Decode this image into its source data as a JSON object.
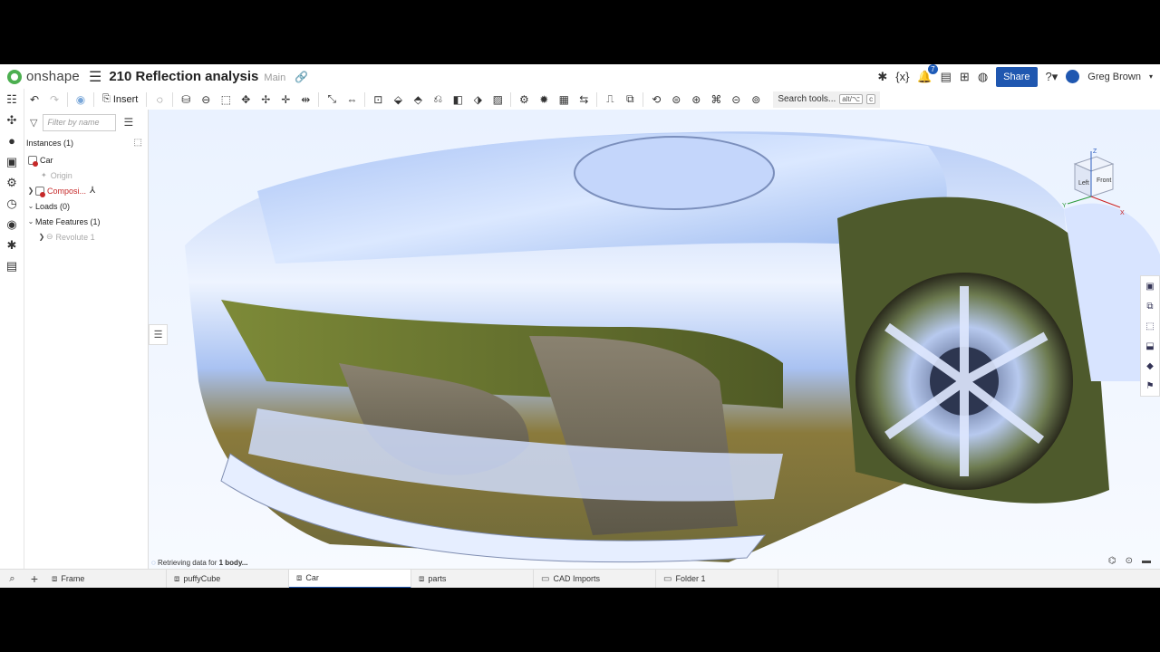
{
  "header": {
    "brand": "onshape",
    "doc_title": "210 Reflection analysis",
    "workspace": "Main",
    "notification_count": "7",
    "share_label": "Share",
    "user_name": "Greg Brown"
  },
  "toolbar": {
    "insert_label": "Insert",
    "search_label": "Search tools...",
    "search_shortcut": "alt/⌥",
    "search_shortcut_key": "c"
  },
  "tree": {
    "filter_placeholder": "Filter by name",
    "instances": "Instances (1)",
    "car": "Car",
    "origin": "Origin",
    "composite": "Composi...",
    "loads": "Loads (0)",
    "mate_features": "Mate Features (1)",
    "revolute": "Revolute 1"
  },
  "viewport": {
    "status_prefix": "Retrieving data for",
    "status_bold": "1 body...",
    "cube_left": "Left",
    "cube_front": "Front",
    "axis_z": "Z",
    "axis_y": "Y",
    "axis_x": "X"
  },
  "tabs": [
    {
      "label": "Frame",
      "icon": "assembly-icon"
    },
    {
      "label": "puffyCube",
      "icon": "assembly-icon"
    },
    {
      "label": "Car",
      "icon": "assembly-icon",
      "active": true
    },
    {
      "label": "parts",
      "icon": "assembly-icon"
    },
    {
      "label": "CAD Imports",
      "icon": "folder-icon"
    },
    {
      "label": "Folder 1",
      "icon": "folder-icon"
    }
  ]
}
